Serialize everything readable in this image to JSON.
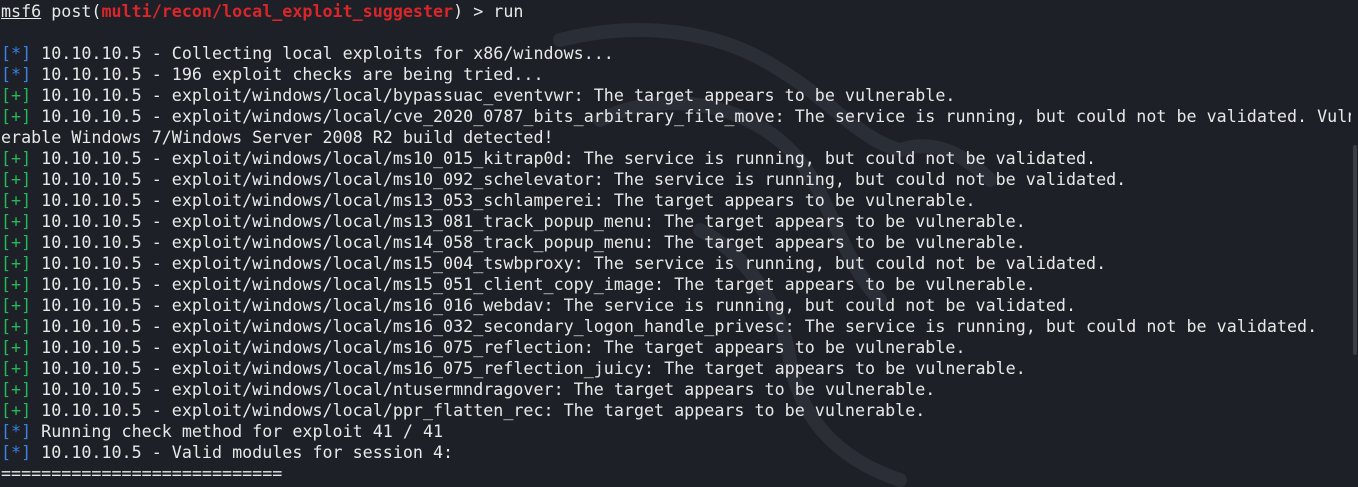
{
  "prompt": {
    "name": "msf6",
    "command": "post",
    "module": "multi/recon/local_exploit_suggester",
    "suffix": ") > run"
  },
  "output": [
    {
      "tag": "[*]",
      "type": "info",
      "text": " 10.10.10.5 - Collecting local exploits for x86/windows..."
    },
    {
      "tag": "[*]",
      "type": "info",
      "text": " 10.10.10.5 - 196 exploit checks are being tried..."
    },
    {
      "tag": "[+]",
      "type": "good",
      "text": " 10.10.10.5 - exploit/windows/local/bypassuac_eventvwr: The target appears to be vulnerable."
    },
    {
      "tag": "[+]",
      "type": "good",
      "text": " 10.10.10.5 - exploit/windows/local/cve_2020_0787_bits_arbitrary_file_move: The service is running, but could not be validated. Vuln"
    },
    {
      "tag": "",
      "type": "plain",
      "text": "erable Windows 7/Windows Server 2008 R2 build detected!"
    },
    {
      "tag": "[+]",
      "type": "good",
      "text": " 10.10.10.5 - exploit/windows/local/ms10_015_kitrap0d: The service is running, but could not be validated."
    },
    {
      "tag": "[+]",
      "type": "good",
      "text": " 10.10.10.5 - exploit/windows/local/ms10_092_schelevator: The service is running, but could not be validated."
    },
    {
      "tag": "[+]",
      "type": "good",
      "text": " 10.10.10.5 - exploit/windows/local/ms13_053_schlamperei: The target appears to be vulnerable."
    },
    {
      "tag": "[+]",
      "type": "good",
      "text": " 10.10.10.5 - exploit/windows/local/ms13_081_track_popup_menu: The target appears to be vulnerable."
    },
    {
      "tag": "[+]",
      "type": "good",
      "text": " 10.10.10.5 - exploit/windows/local/ms14_058_track_popup_menu: The target appears to be vulnerable."
    },
    {
      "tag": "[+]",
      "type": "good",
      "text": " 10.10.10.5 - exploit/windows/local/ms15_004_tswbproxy: The service is running, but could not be validated."
    },
    {
      "tag": "[+]",
      "type": "good",
      "text": " 10.10.10.5 - exploit/windows/local/ms15_051_client_copy_image: The target appears to be vulnerable."
    },
    {
      "tag": "[+]",
      "type": "good",
      "text": " 10.10.10.5 - exploit/windows/local/ms16_016_webdav: The service is running, but could not be validated."
    },
    {
      "tag": "[+]",
      "type": "good",
      "text": " 10.10.10.5 - exploit/windows/local/ms16_032_secondary_logon_handle_privesc: The service is running, but could not be validated."
    },
    {
      "tag": "[+]",
      "type": "good",
      "text": " 10.10.10.5 - exploit/windows/local/ms16_075_reflection: The target appears to be vulnerable."
    },
    {
      "tag": "[+]",
      "type": "good",
      "text": " 10.10.10.5 - exploit/windows/local/ms16_075_reflection_juicy: The target appears to be vulnerable."
    },
    {
      "tag": "[+]",
      "type": "good",
      "text": " 10.10.10.5 - exploit/windows/local/ntusermndragover: The target appears to be vulnerable."
    },
    {
      "tag": "[+]",
      "type": "good",
      "text": " 10.10.10.5 - exploit/windows/local/ppr_flatten_rec: The target appears to be vulnerable."
    },
    {
      "tag": "[*]",
      "type": "info",
      "text": " Running check method for exploit 41 / 41"
    },
    {
      "tag": "[*]",
      "type": "info",
      "text": " 10.10.10.5 - Valid modules for session 4:"
    }
  ],
  "separator": "============================",
  "colors": {
    "background": "#1d2026",
    "foreground": "#e8e8e8",
    "info_tag": "#3b82e6",
    "good_tag": "#25b85a",
    "module_highlight": "#d8262a"
  },
  "background_icon": "kali-dragon-watermark-icon"
}
